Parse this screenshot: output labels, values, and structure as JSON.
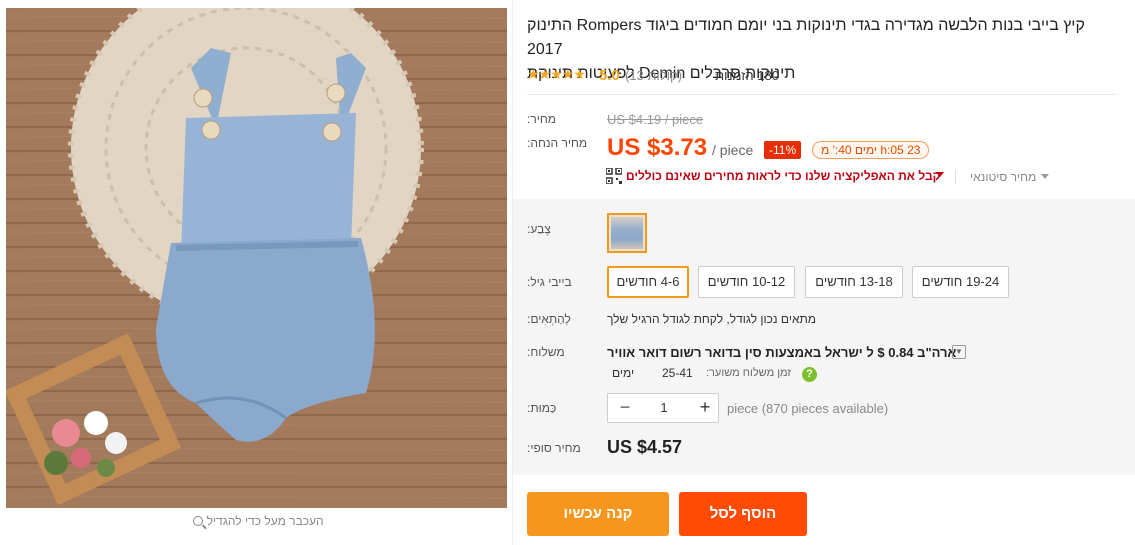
{
  "gallery": {
    "zoom_hint": "העכבר מעל כדי להגדיל"
  },
  "product": {
    "title_line1": "קיץ בייבי בנות הלבשה מגדירה בגדי תינוקות בני יומם חמודים ביגוד Rompers התינוק 2017",
    "title_line2": "תינוקות סרבלים Demin לפעוטות תינוקת",
    "rating": {
      "stars": "★★★★★",
      "score": "5.0",
      "votes": "(13 קולות)",
      "orders": "180 הזמנות"
    }
  },
  "pricing": {
    "price_label": "מחיר:",
    "old_price": "US $4.19 / piece",
    "discount_label": "מחיר הנחה:",
    "new_price": "US $3.73",
    "per_piece": "/ piece",
    "discount_badge": "-11%",
    "timer": "23 h:05 ימים 40:' מ",
    "app_promo": "קבל את האפליקציה שלנו כדי לראות מחירים שאינם כוללים",
    "wholesale": "מחיר סיטונאי"
  },
  "options": {
    "color_label": "צֶבַע:",
    "age_label": "בייבי גיל:",
    "sizes": [
      "4-6 חודשים",
      "10-12 חודשים",
      "13-18 חודשים",
      "19-24 חודשים"
    ],
    "fit_label": "לְהַתְאִים:",
    "fit_text": "מתאים נכון לגודל, לקחת לגודל הרגיל שלך"
  },
  "shipping": {
    "label": "משלוח:",
    "method": "ארה\"ב 0.84 $ ל ישראל באמצעות סין בדואר רשום דואר אוויר",
    "time_label": "זמן משלוח משוער:",
    "days": "25-41",
    "days_unit": "ימים"
  },
  "quantity": {
    "label": "כַּמוּת:",
    "value": "1",
    "minus": "−",
    "plus": "+",
    "available": "piece (870 pieces available)"
  },
  "total": {
    "label": "מחיר סופי:",
    "value": "US $4.57"
  },
  "buttons": {
    "buy_now": "קנה עכשיו",
    "add_to_cart": "הוסף לסל"
  },
  "colors": {
    "accent_orange": "#f7961e",
    "cart_red": "#ff4b06",
    "price_red": "#ff4400",
    "star": "#f5a623"
  }
}
